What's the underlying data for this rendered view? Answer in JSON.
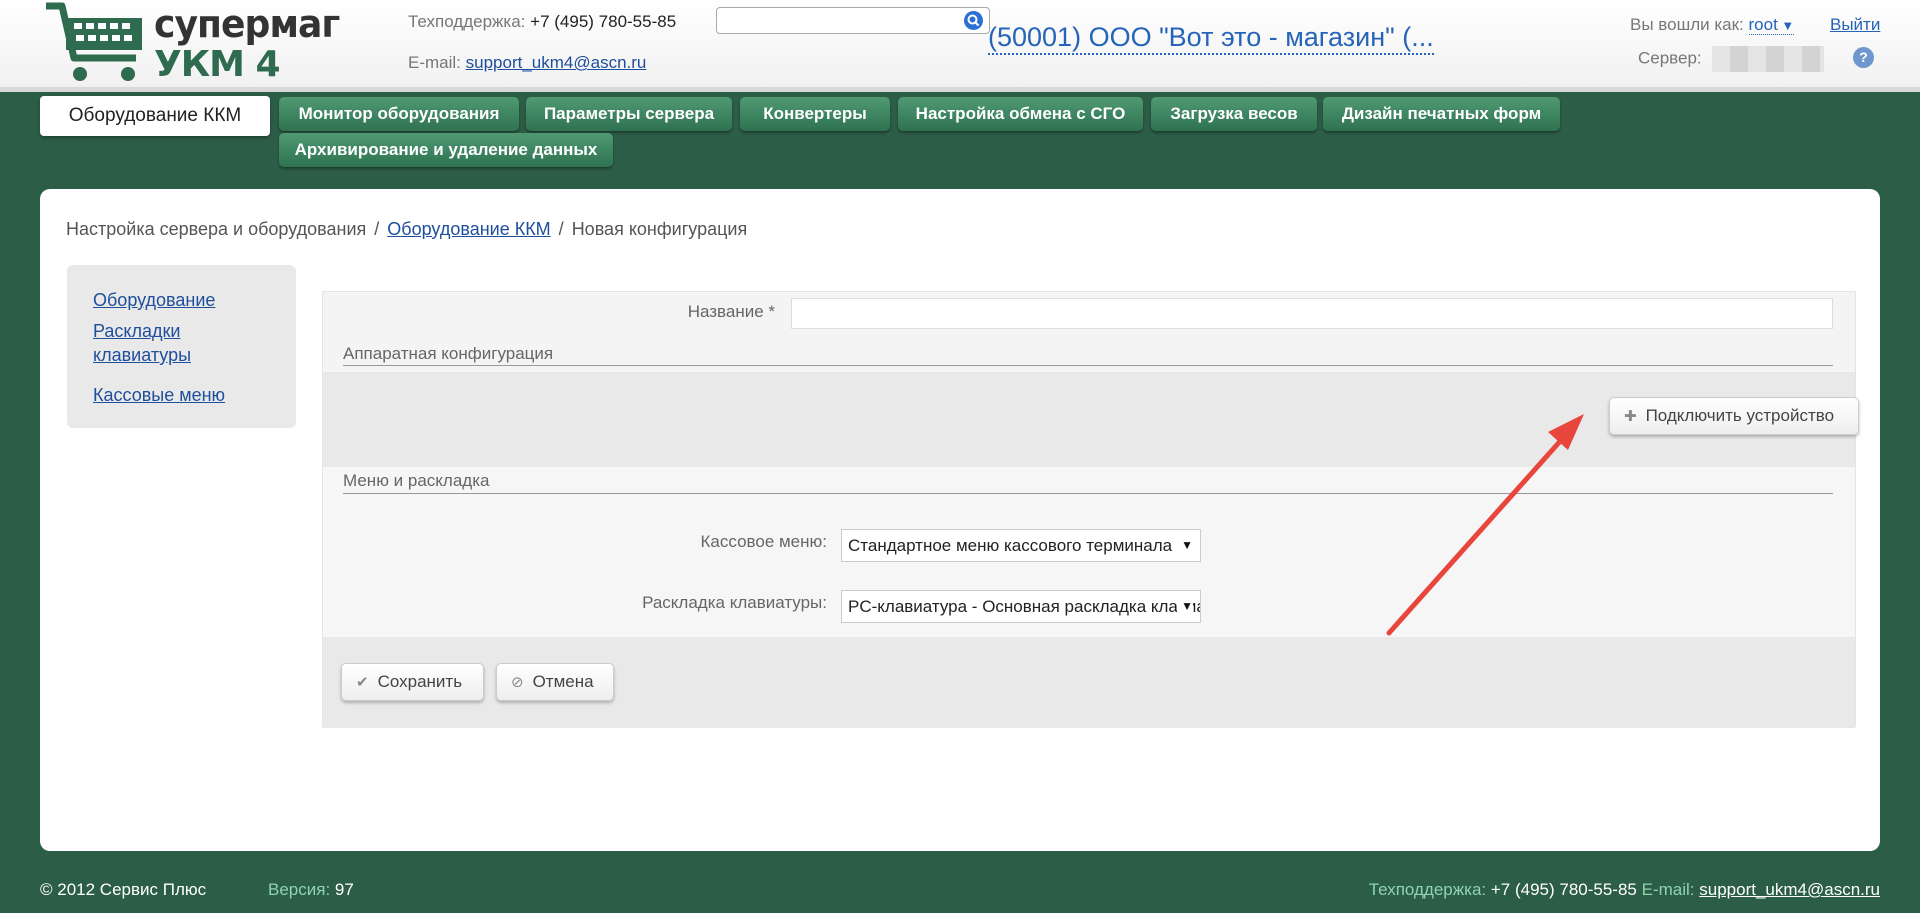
{
  "app": {
    "logo_line1": "супермаг",
    "logo_line2": "УКМ 4",
    "brand_color": "#2e6b4f"
  },
  "header": {
    "support_label": "Техподдержка:",
    "support_phone": "+7 (495) 780-55-85",
    "email_label": "E-mail:",
    "email": "support_ukm4@ascn.ru",
    "search_value": "",
    "store_title": "(50001) ООО \"Вот это - магазин\" (...",
    "logged_in_label": "Вы вошли как:",
    "username": "root",
    "logout_label": "Выйти",
    "server_label": "Сервер:",
    "help_label": "?"
  },
  "nav": {
    "active_tab": "Оборудование ККМ",
    "tabs": [
      "Монитор оборудования",
      "Параметры сервера",
      "Конвертеры",
      "Настройка обмена с СГО",
      "Загрузка весов",
      "Дизайн печатных форм",
      "Архивирование и удаление данных"
    ]
  },
  "breadcrumb": {
    "root": "Настройка сервера и оборудования",
    "link": "Оборудование ККМ",
    "current": "Новая конфигурация",
    "separator": "/"
  },
  "sidebar": {
    "items": [
      "Оборудование",
      "Раскладки клавиатуры",
      "Кассовые меню"
    ]
  },
  "form": {
    "name_label": "Название *",
    "name_value": "",
    "hw_section_title": "Аппаратная конфигурация",
    "connect_button": "Подключить устройство",
    "menu_section_title": "Меню и раскладка",
    "cash_menu_label": "Кассовое меню:",
    "cash_menu_value": "Стандартное меню кассового терминала",
    "keyboard_label": "Раскладка клавиатуры:",
    "keyboard_value": "PC-клавиатура - Основная раскладка клавиатуры",
    "save_button": "Сохранить",
    "cancel_button": "Отмена"
  },
  "footer": {
    "copyright": "© 2012 Сервис Плюс",
    "version_label": "Версия:",
    "version_value": "97",
    "support_label": "Техподдержка:",
    "support_phone": "+7 (495) 780-55-85",
    "email_label": "E-mail:",
    "email": "support_ukm4@ascn.ru"
  },
  "colors": {
    "background": "#2c5d47",
    "tab_green": "#3d8660",
    "link_blue": "#1f4e9c",
    "annotation_arrow": "#e8453c"
  }
}
